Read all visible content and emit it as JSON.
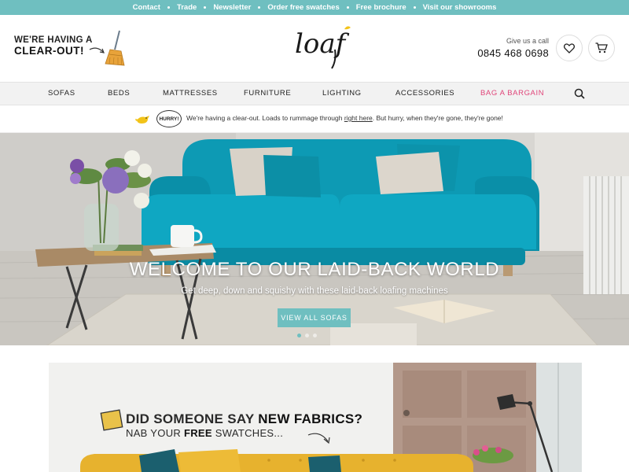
{
  "topbar": {
    "links": [
      "Contact",
      "Trade",
      "Newsletter",
      "Order free swatches",
      "Free brochure",
      "Visit our showrooms"
    ]
  },
  "header": {
    "clearout_line1": "WE'RE HAVING A",
    "clearout_line2": "CLEAR-OUT!",
    "logo_text": "loaf",
    "call_label": "Give us a call",
    "phone": "0845 468 0698",
    "icons": [
      "broom-icon",
      "heart-icon",
      "cart-icon"
    ]
  },
  "nav": {
    "items": [
      "SOFAS",
      "BEDS",
      "MATTRESSES",
      "FURNITURE",
      "LIGHTING",
      "ACCESSORIES",
      "BAG A BARGAIN"
    ],
    "highlight_color": "#e0467a",
    "search_icon": "search-icon"
  },
  "notice": {
    "badge": "HURRY!",
    "text_before": "We're having a clear-out. Loads to rummage through ",
    "link": "right here",
    "text_after": ". But hurry, when they're gone, they're gone!"
  },
  "hero": {
    "title": "WELCOME TO OUR LAID-BACK WORLD",
    "subtitle": "Get deep, down and squishy with these laid-back loafing machines",
    "button": "VIEW ALL SOFAS",
    "accent": "#6fbfc0",
    "sofa_color": "#0e9bb5"
  },
  "promo": {
    "headline_prefix": "DID SOMEONE SAY ",
    "headline_highlight": "NEW FABRICS?",
    "sub_prefix": "NAB YOUR ",
    "sub_highlight": "FREE",
    "sub_suffix": " SWATCHES..."
  }
}
